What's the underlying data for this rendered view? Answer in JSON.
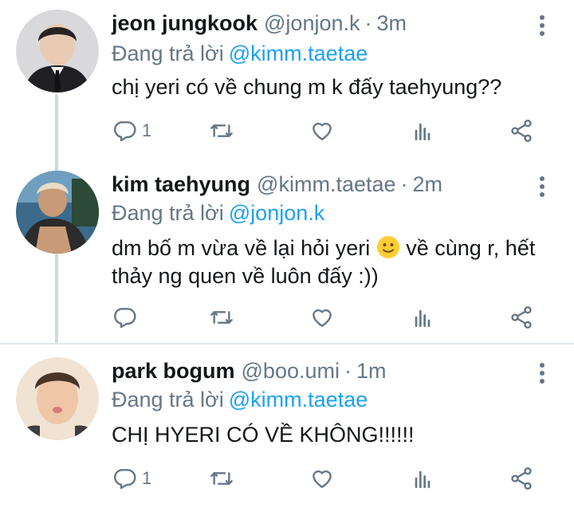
{
  "tweets": [
    {
      "display_name": "jeon jungkook",
      "handle": "@jonjon.k",
      "separator": "·",
      "time": "3m",
      "reply_prefix": "Đang trả lời",
      "reply_to": "@kimm.taetae",
      "text": "chị yeri có về chung m k đấy taehyung??",
      "reply_count": "1"
    },
    {
      "display_name": "kim taehyung",
      "handle": "@kimm.taetae",
      "separator": "·",
      "time": "2m",
      "reply_prefix": "Đang trả lời",
      "reply_to": "@jonjon.k",
      "text_part1": "dm bố m vừa về lại hỏi yeri",
      "text_part2": "về cùng r, hết thảy ng quen về luôn đấy :))",
      "reply_count": ""
    },
    {
      "display_name": "park bogum",
      "handle": "@boo.umi",
      "separator": "·",
      "time": "1m",
      "reply_prefix": "Đang trả lời",
      "reply_to": "@kimm.taetae",
      "text": "CHỊ HYERI CÓ VỀ KHÔNG!!!!!!",
      "reply_count": "1"
    }
  ],
  "icons": {
    "reply": "reply-icon",
    "retweet": "retweet-icon",
    "like": "heart-icon",
    "stats": "analytics-icon",
    "share": "share-icon",
    "more": "more-options-icon"
  },
  "colors": {
    "link": "#1da1f2",
    "secondary_text": "#657786",
    "icon": "#657786",
    "thread_line": "#cfd9de",
    "divider": "#e1e8ed"
  }
}
